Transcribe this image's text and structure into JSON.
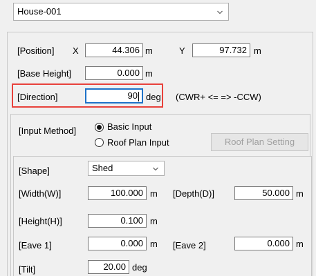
{
  "house_select": {
    "value": "House-001"
  },
  "position": {
    "label": "[Position]",
    "x_label": "X",
    "x_value": "44.306",
    "x_unit": "m",
    "y_label": "Y",
    "y_value": "97.732",
    "y_unit": "m"
  },
  "base_height": {
    "label": "[Base Height]",
    "value": "0.000",
    "unit": "m"
  },
  "direction": {
    "label": "[Direction]",
    "value": "90",
    "unit": "deg",
    "hint": "(CWR+ <= => -CCW)",
    "highlight_color": "#e8413b"
  },
  "input_method": {
    "label": "[Input Method]",
    "option1": "Basic Input",
    "option1_selected": true,
    "option2": "Roof Plan Input",
    "roof_plan_button": "Roof Plan Setting"
  },
  "shape": {
    "label": "[Shape]",
    "value": "Shed"
  },
  "width": {
    "label": "[Width(W)]",
    "value": "100.000",
    "unit": "m"
  },
  "depth": {
    "label": "[Depth(D)]",
    "value": "50.000",
    "unit": "m"
  },
  "height": {
    "label": "[Height(H)]",
    "value": "0.100",
    "unit": "m"
  },
  "eave1": {
    "label": "[Eave 1]",
    "value": "0.000",
    "unit": "m"
  },
  "eave2": {
    "label": "[Eave 2]",
    "value": "0.000",
    "unit": "m"
  },
  "tilt": {
    "label": "[Tilt]",
    "value": "20.00",
    "unit": "deg"
  },
  "icons": {
    "dropdown": "chevron-down-icon",
    "radio": "radio-button-icon"
  }
}
